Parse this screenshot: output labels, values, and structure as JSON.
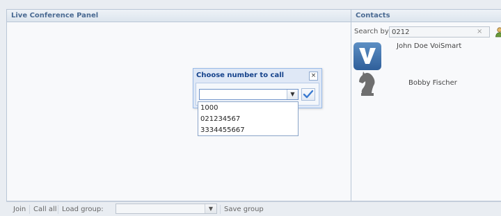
{
  "conference_panel": {
    "title": "Live Conference Panel"
  },
  "contacts": {
    "title": "Contacts",
    "search_label": "Search by",
    "search_value": "0212",
    "clear_icon": "×",
    "items": [
      {
        "name": "John Doe VoiSmart",
        "avatar": "voismart-logo"
      },
      {
        "name": "Bobby Fischer",
        "avatar": "chess-knight"
      }
    ]
  },
  "dialog": {
    "title": "Choose number to call",
    "close_icon": "×",
    "selected": "",
    "options": [
      "1000",
      "021234567",
      "3334455667"
    ]
  },
  "bottom_bar": {
    "join": "Join",
    "call_all": "Call all",
    "load_group": "Load group:",
    "load_group_value": "",
    "save_group": "Save group"
  },
  "colors": {
    "header_text": "#4a6a92",
    "dialog_title": "#15428b"
  }
}
